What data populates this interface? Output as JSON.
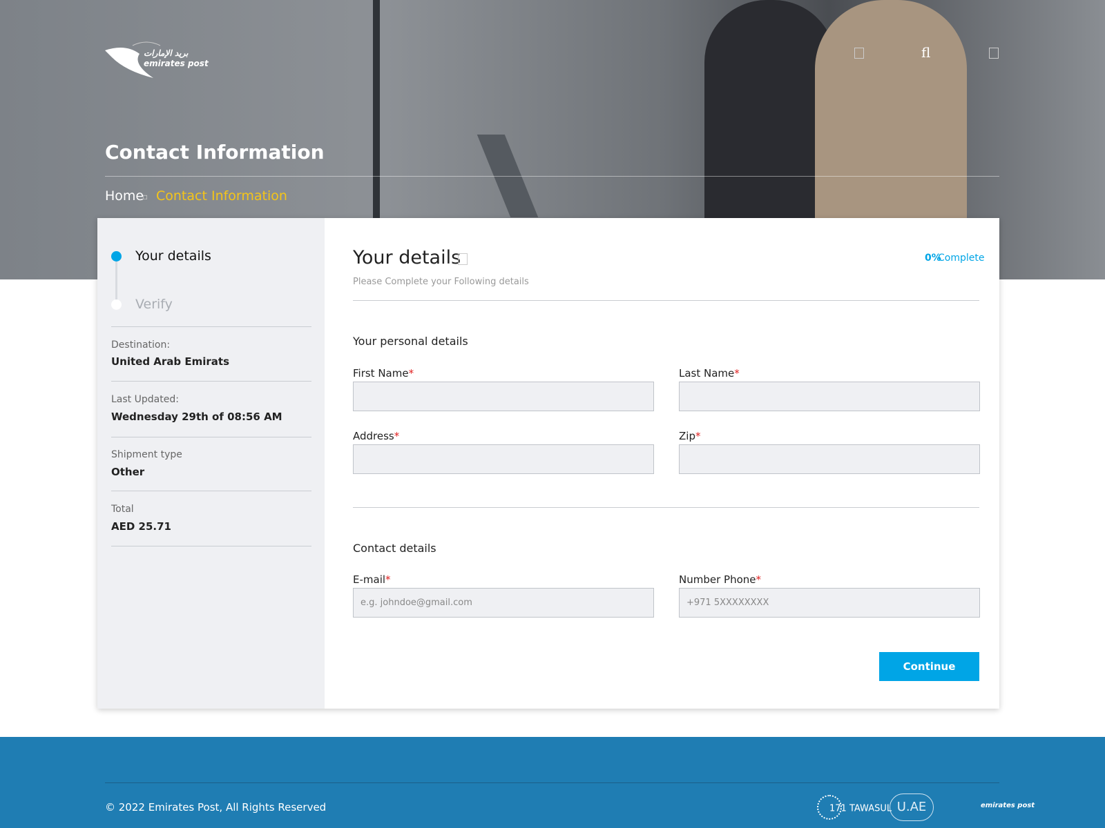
{
  "header": {
    "logo_text": "emirates post",
    "logo_arabic": "بريد الإمارات",
    "icons": [
      "square-icon",
      "fl-icon",
      "square-icon"
    ],
    "title": "Contact Information"
  },
  "breadcrumb": {
    "home": "Home",
    "separator": "▫",
    "current": "Contact Information"
  },
  "sidebar": {
    "steps": [
      {
        "label": "Your details",
        "active": true
      },
      {
        "label": "Verify",
        "active": false
      }
    ],
    "info": [
      {
        "label": "Destination:",
        "value": "United Arab Emirats"
      },
      {
        "label": "Last Updated:",
        "value": "Wednesday 29th of 08:56 AM"
      },
      {
        "label": "Shipment type",
        "value": "Other"
      },
      {
        "label": "Total",
        "value": "AED 25.71"
      }
    ]
  },
  "form": {
    "title": "Your details",
    "percent": "0%",
    "complete": "Complete",
    "subtitle": "Please Complete your Following details",
    "personal_heading": "Your personal details",
    "contact_heading": "Contact details",
    "required_mark": "*",
    "fields": {
      "first_name": {
        "label": "First Name",
        "value": ""
      },
      "last_name": {
        "label": "Last Name",
        "value": ""
      },
      "address": {
        "label": "Address",
        "value": ""
      },
      "zip": {
        "label": "Zip",
        "value": ""
      },
      "email": {
        "label": "E-mail",
        "placeholder": "e.g. johndoe@gmail.com"
      },
      "phone": {
        "label": "Number Phone",
        "placeholder": "+971 5XXXXXXXX"
      }
    },
    "continue": "Continue"
  },
  "footer": {
    "copyright": "© 2022 Emirates Post, All Rights Reserved",
    "logos": [
      "171 TAWASUL",
      "U.AE",
      "emirates post"
    ]
  },
  "colors": {
    "accent": "#00a5e6",
    "breadcrumb_current": "#f5c518",
    "footer": "#1f7db3",
    "required": "#e02020"
  }
}
